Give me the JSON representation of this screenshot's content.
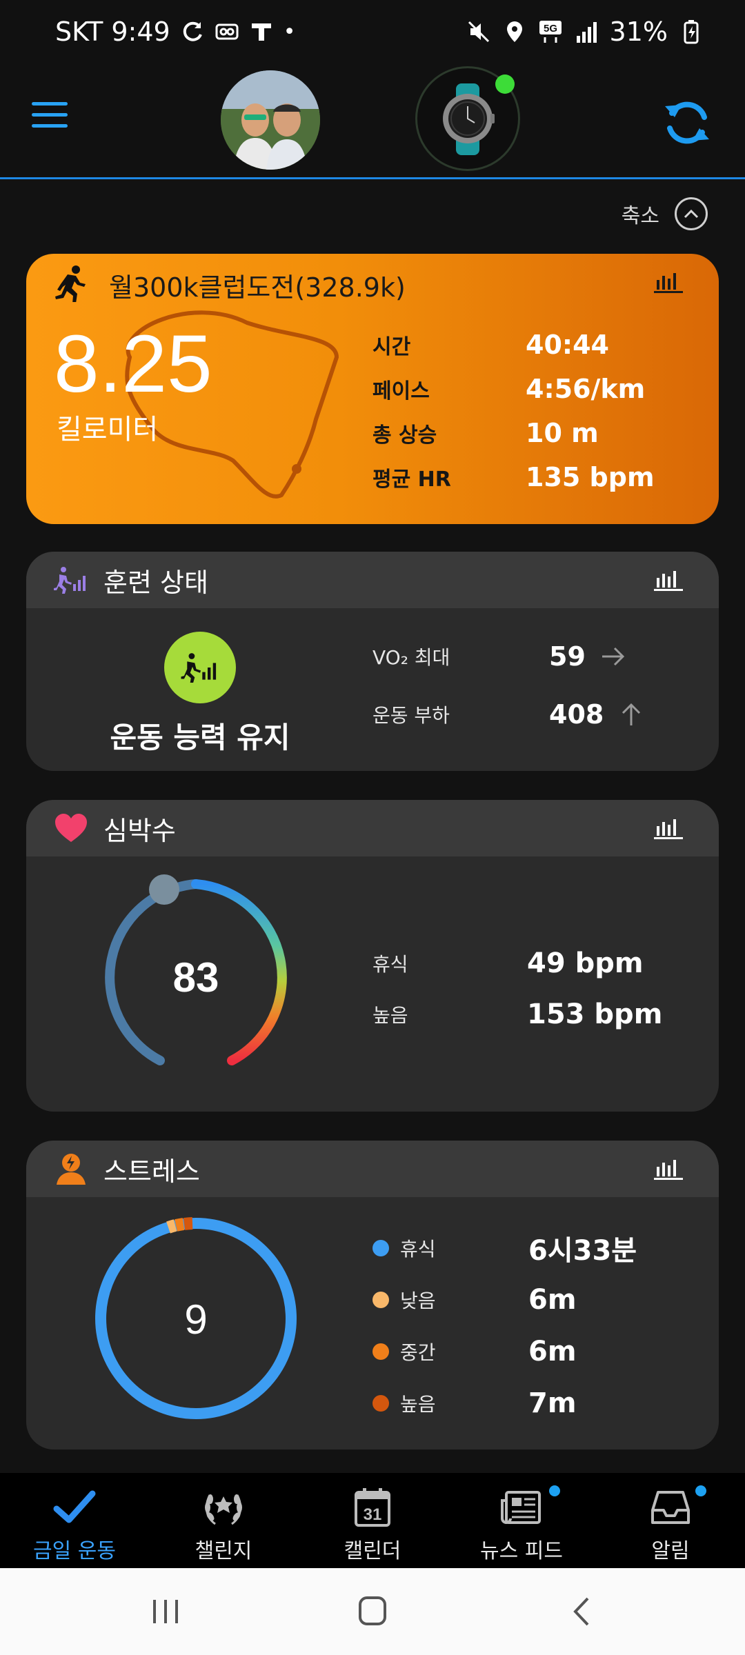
{
  "status_bar": {
    "carrier_time": "SKT 9:49",
    "battery": "31%",
    "network": "5G"
  },
  "app_bar": {
    "menu_icon": "hamburger-icon",
    "sync_icon": "sync-icon",
    "accent": "#29a3f5"
  },
  "collapse": {
    "label": "축소"
  },
  "activity": {
    "title": "월300k클럽도전(328.9k)",
    "distance": "8.25",
    "distance_unit": "킬로미터",
    "stats": [
      {
        "label": "시간",
        "value": "40:44"
      },
      {
        "label": "페이스",
        "value": "4:56/km"
      },
      {
        "label": "총 상승",
        "value": "10 m"
      },
      {
        "label": "평균 HR",
        "value": "135 bpm"
      }
    ]
  },
  "training": {
    "title": "훈련 상태",
    "status": "운동 능력 유지",
    "rows": [
      {
        "label": "VO₂ 최대",
        "value": "59",
        "trend": "flat"
      },
      {
        "label": "운동 부하",
        "value": "408",
        "trend": "up"
      }
    ]
  },
  "heart_rate": {
    "title": "심박수",
    "current": "83",
    "rows": [
      {
        "label": "휴식",
        "value": "49 bpm"
      },
      {
        "label": "높음",
        "value": "153 bpm"
      }
    ]
  },
  "stress": {
    "title": "스트레스",
    "current": "9",
    "rows": [
      {
        "label": "휴식",
        "value": "6시33분",
        "color": "#3d9df2"
      },
      {
        "label": "낮음",
        "value": "6m",
        "color": "#f9b86a"
      },
      {
        "label": "중간",
        "value": "6m",
        "color": "#f07f1a"
      },
      {
        "label": "높음",
        "value": "7m",
        "color": "#d4570e"
      }
    ]
  },
  "bottom_nav": [
    {
      "label": "금일 운동",
      "icon": "check-icon",
      "active": true,
      "badge": false
    },
    {
      "label": "챌린지",
      "icon": "laurel-icon",
      "active": false,
      "badge": false
    },
    {
      "label": "캘린더",
      "icon": "calendar-icon",
      "active": false,
      "badge": false,
      "day": "31"
    },
    {
      "label": "뉴스 피드",
      "icon": "newspaper-icon",
      "active": false,
      "badge": true
    },
    {
      "label": "알림",
      "icon": "inbox-icon",
      "active": false,
      "badge": true
    }
  ]
}
